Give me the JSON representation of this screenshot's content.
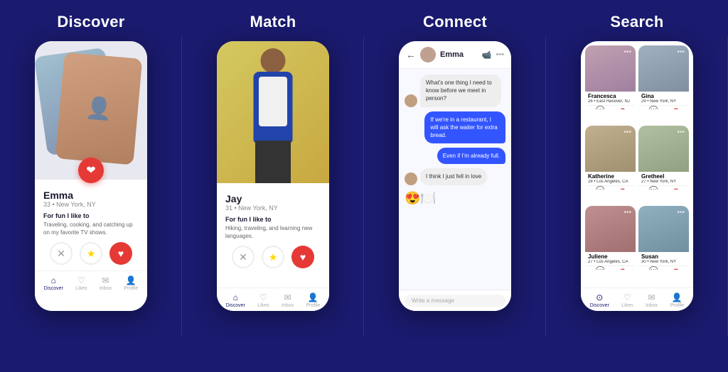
{
  "sections": [
    {
      "id": "discover",
      "title": "Discover",
      "profile": {
        "name": "Emma",
        "age": "33",
        "location": "New York, NY",
        "section_label": "For fun I like to",
        "description": "Traveling, cooking, and catching up on my favorite TV shows."
      },
      "nav": [
        "Discover",
        "Likes",
        "Inbox",
        "Profile"
      ]
    },
    {
      "id": "match",
      "title": "Match",
      "profile": {
        "name": "Jay",
        "age": "31",
        "location": "New York, NY",
        "section_label": "For fun I like to",
        "description": "Hiking, traveling, and learning new languages."
      },
      "nav": [
        "Discover",
        "Likes",
        "Inbox",
        "Profile"
      ]
    },
    {
      "id": "connect",
      "title": "Connect",
      "chat": {
        "contact": "Emma",
        "messages": [
          {
            "type": "received",
            "text": "What's one thing I need to know before we meet in person?"
          },
          {
            "type": "sent",
            "text": "If we're in a restaurant, I will ask the waiter for extra bread."
          },
          {
            "type": "sent",
            "text": "Even if I'm already full."
          },
          {
            "type": "received",
            "text": "I think I just fell in love"
          },
          {
            "type": "emoji",
            "text": "😍🍽️"
          }
        ],
        "input_placeholder": "Write a message"
      }
    },
    {
      "id": "search",
      "title": "Search",
      "profiles": [
        {
          "name": "Francesca",
          "age": "26",
          "location": "East Hanover, NJ"
        },
        {
          "name": "Gina",
          "age": "29",
          "location": "New York, NY"
        },
        {
          "name": "Katherine",
          "age": "28",
          "location": "Los Angeles, CA"
        },
        {
          "name": "Gretheel",
          "age": "27",
          "location": "New York, NY"
        },
        {
          "name": "Juliene",
          "age": "27",
          "location": "Los Angeles, CA"
        },
        {
          "name": "Susan",
          "age": "30",
          "location": "New York, NY"
        }
      ],
      "nav": [
        "Discover",
        "Likes",
        "Inbox",
        "Profile"
      ]
    }
  ]
}
